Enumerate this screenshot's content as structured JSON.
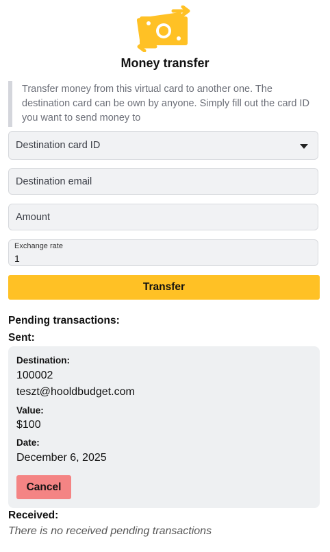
{
  "header": {
    "icon": "money-transfer-icon",
    "title": "Money transfer"
  },
  "description": "Transfer money from this virtual card to another one. The destination card can be own by anyone. Simply fill out the card ID you want to send money to",
  "form": {
    "destination_card_placeholder": "Destination card ID",
    "destination_email_placeholder": "Destination email",
    "amount_placeholder": "Amount",
    "exchange_rate_label": "Exchange rate",
    "exchange_rate_value": "1",
    "transfer_label": "Transfer"
  },
  "pending": {
    "heading": "Pending transactions:",
    "sent_heading": "Sent:",
    "sent": [
      {
        "destination_label": "Destination:",
        "card_id": "100002",
        "email": "teszt@hooldbudget.com",
        "value_label": "Value:",
        "value": "$100",
        "date_label": "Date:",
        "date": "December 6, 2025",
        "cancel_label": "Cancel"
      }
    ],
    "received_heading": "Received:",
    "received_empty": "There is no received pending transactions"
  },
  "colors": {
    "accent": "#ffc125",
    "cancel": "#f48484",
    "field_bg": "#f1f2f4",
    "card_bg": "#eef0f2"
  }
}
